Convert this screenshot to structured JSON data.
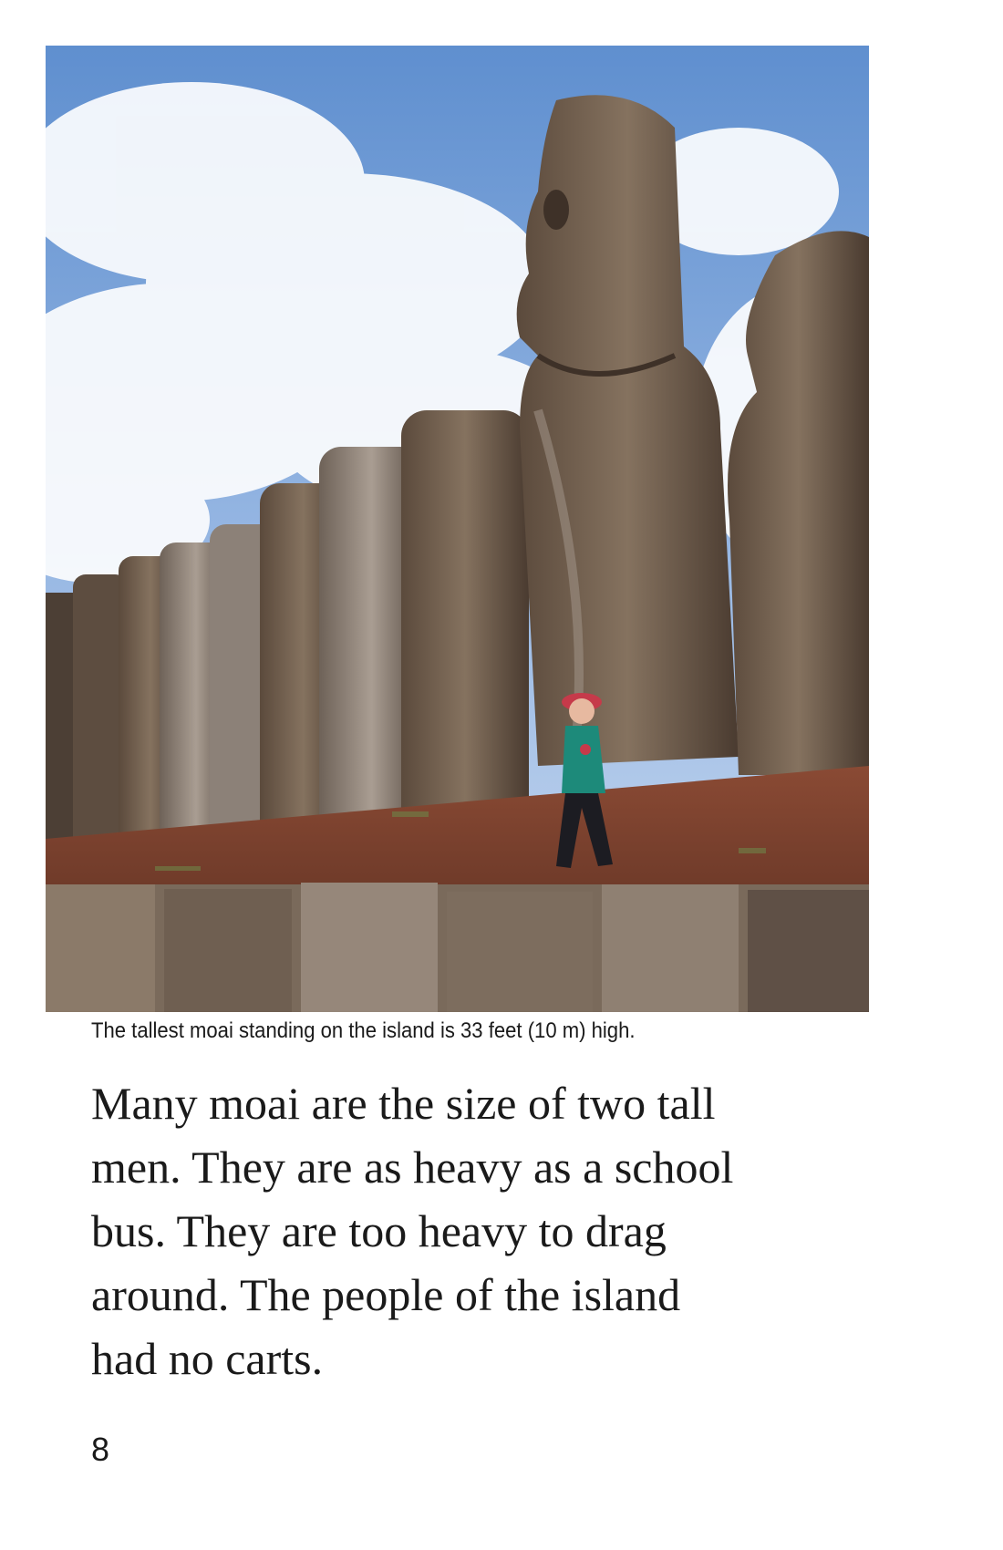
{
  "photo": {
    "subject": "Row of moai statues with a child walking in front"
  },
  "caption": "The tallest moai standing on the island is 33 feet (10 m) high.",
  "body": {
    "lines": [
      "Many moai are the size of two tall",
      "men. They are as heavy as a school",
      "bus. They are too heavy to drag",
      "around. The people of the island",
      "had no carts."
    ]
  },
  "page_number": "8"
}
